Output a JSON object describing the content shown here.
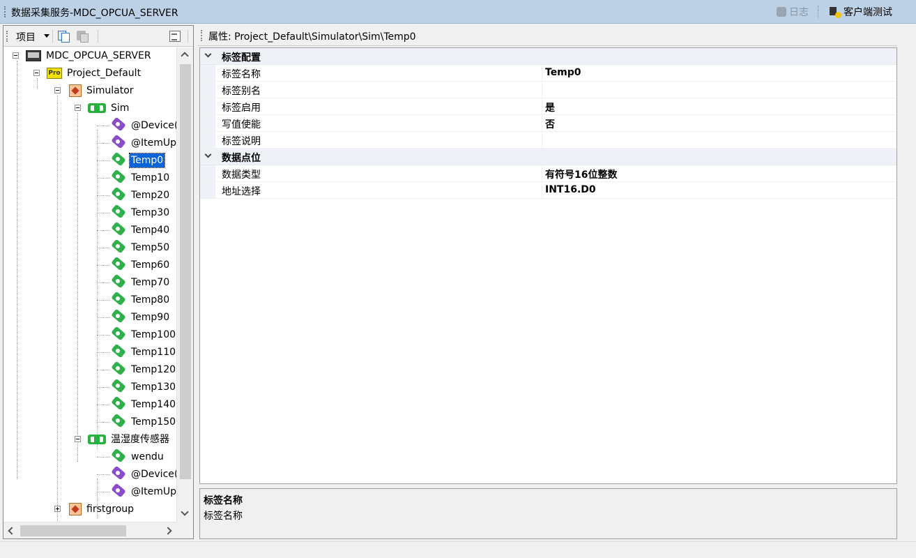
{
  "window": {
    "title": "数据采集服务-MDC_OPCUA_SERVER",
    "log_label": "日志",
    "client_test_label": "客户端测试"
  },
  "left_toolbar": {
    "project_label": "项目"
  },
  "tree": {
    "server": "MDC_OPCUA_SERVER",
    "project": "Project_Default",
    "channel_sim": "Simulator",
    "device_sim": "Sim",
    "sim_tags": [
      "@Device(",
      "@ItemUp",
      "Temp0",
      "Temp10",
      "Temp20",
      "Temp30",
      "Temp40",
      "Temp50",
      "Temp60",
      "Temp70",
      "Temp80",
      "Temp90",
      "Temp100",
      "Temp110",
      "Temp120",
      "Temp130",
      "Temp140",
      "Temp150"
    ],
    "device_th": "温湿度传感器",
    "th_tags": [
      "wendu",
      "@Device(",
      "@ItemUp"
    ],
    "channel_first": "firstgroup",
    "selected": "Temp0"
  },
  "properties": {
    "header": "属性: Project_Default\\Simulator\\Sim\\Temp0",
    "cat1": "标签配置",
    "rows1": [
      {
        "name": "标签名称",
        "value": "Temp0"
      },
      {
        "name": "标签别名",
        "value": ""
      },
      {
        "name": "标签启用",
        "value": "是"
      },
      {
        "name": "写值使能",
        "value": "否"
      },
      {
        "name": "标签说明",
        "value": ""
      }
    ],
    "cat2": "数据点位",
    "rows2": [
      {
        "name": "数据类型",
        "value": "有符号16位整数"
      },
      {
        "name": "地址选择",
        "value": "INT16.D0"
      }
    ]
  },
  "description": {
    "title": "标签名称",
    "text": "标签名称"
  },
  "icons": {
    "server": "server-icon",
    "project": "project-icon",
    "channel": "channel-icon",
    "device": "device-icon",
    "tag_user": "tag-green-icon",
    "tag_system": "tag-purple-icon"
  },
  "colors": {
    "titlebar": "#bcd0e6",
    "selection": "#0a64d8",
    "tag_green": "#2fb04a",
    "tag_purple": "#8a4cc9"
  }
}
